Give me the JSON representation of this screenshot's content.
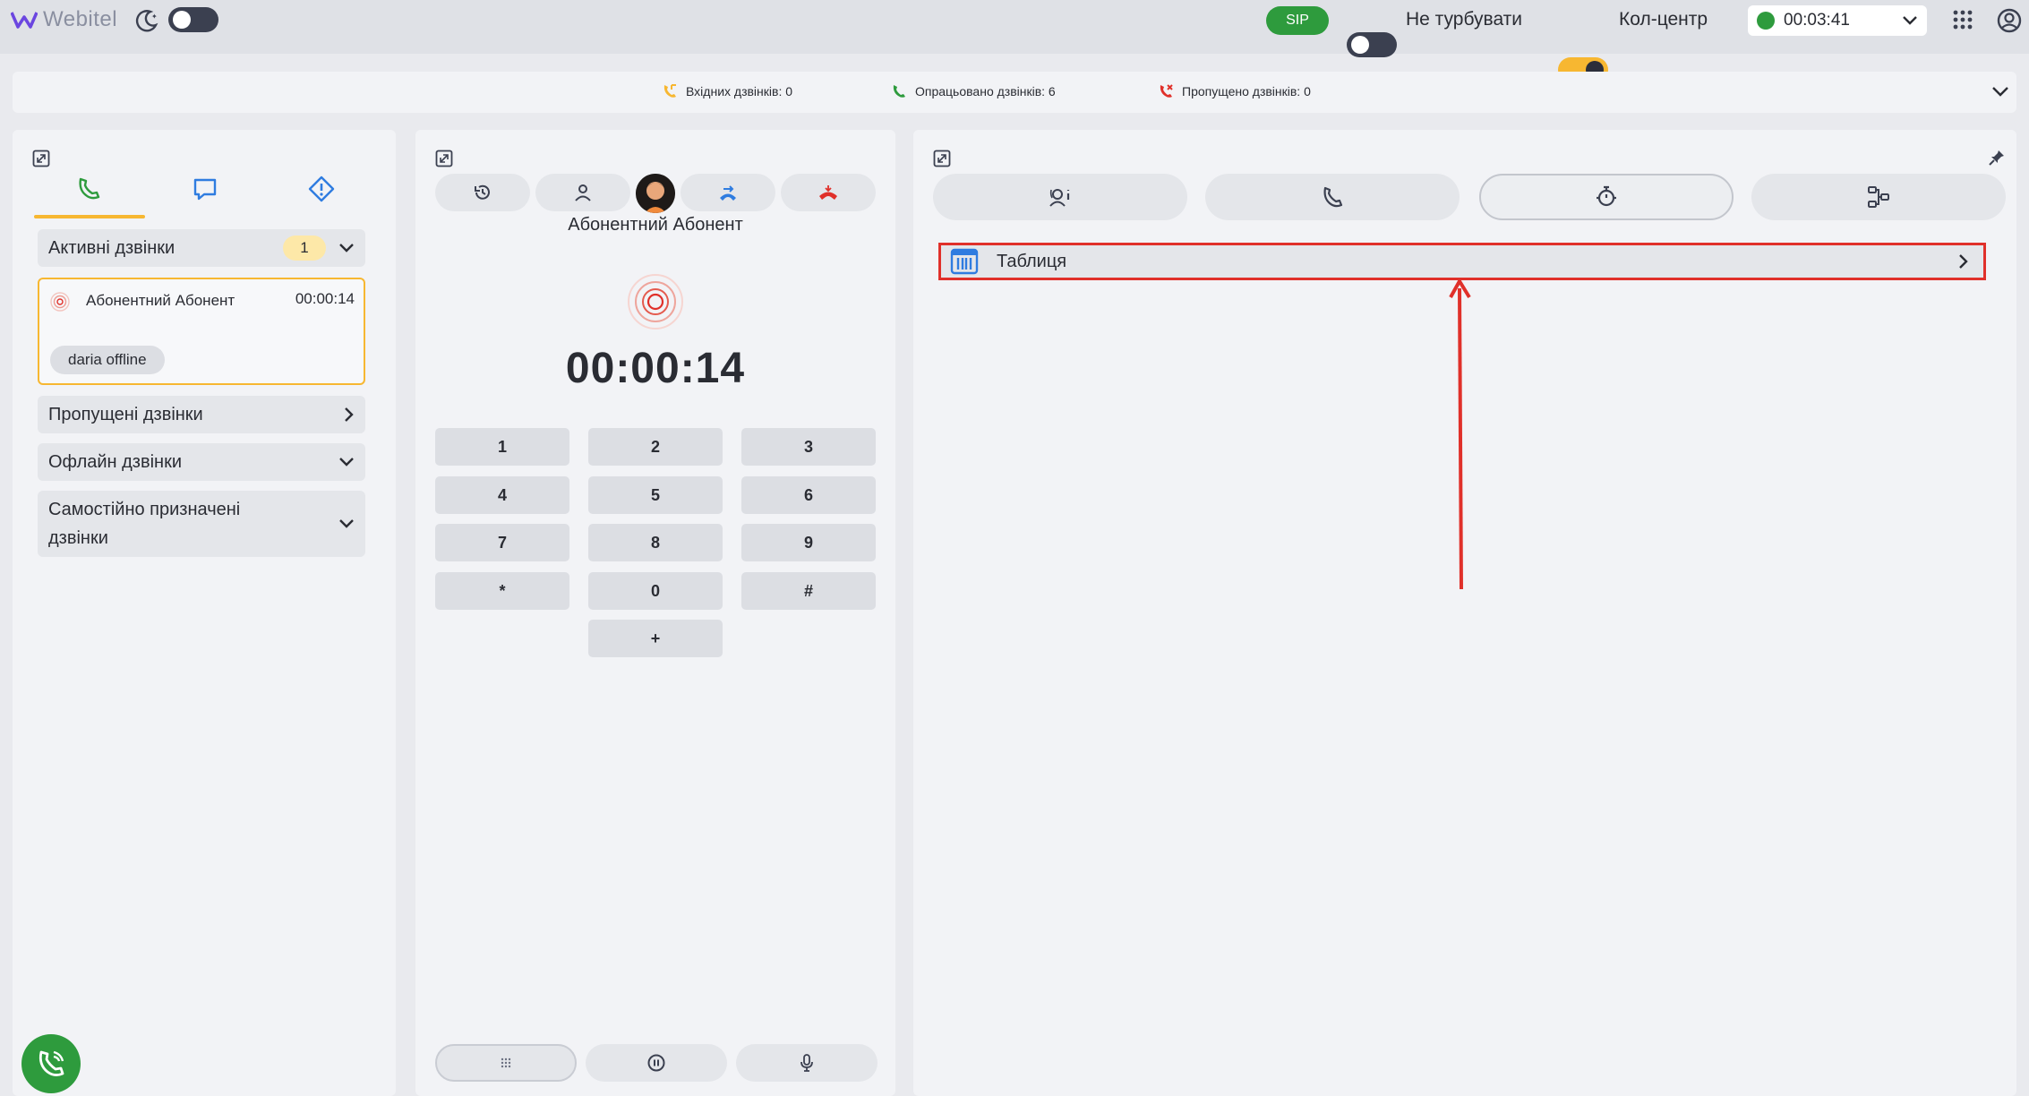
{
  "topbar": {
    "logo_text": "Webitel",
    "sip_label": "SIP",
    "dnd_label": "Не турбувати",
    "callcenter_label": "Кол-центр",
    "status_time": "00:03:41"
  },
  "stats": {
    "incoming": "Вхідних дзвінків: 0",
    "processed": "Опрацьовано дзвінків: 6",
    "missed": "Пропущено дзвінків: 0"
  },
  "left": {
    "active_calls": {
      "label": "Активні дзвінки",
      "count": "1"
    },
    "active_card": {
      "name": "Абонентний Абонент",
      "time": "00:00:14",
      "chip": "daria offline"
    },
    "missed_calls": "Пропущені дзвінки",
    "offline_calls": "Офлайн дзвінки",
    "self_assigned_line1": "Самостійно призначені",
    "self_assigned_line2": "дзвінки"
  },
  "mid": {
    "caller_name": "Абонентний Абонент",
    "timer": "00:00:14",
    "keys": [
      "1",
      "2",
      "3",
      "4",
      "5",
      "6",
      "7",
      "8",
      "9",
      "*",
      "0",
      "#",
      "+"
    ]
  },
  "right": {
    "table_label": "Таблиця"
  },
  "colors": {
    "accent_yellow": "#f7b731",
    "green": "#2e9b3d",
    "highlight_red": "#e0302a",
    "blue_icon": "#2f7ce0"
  }
}
